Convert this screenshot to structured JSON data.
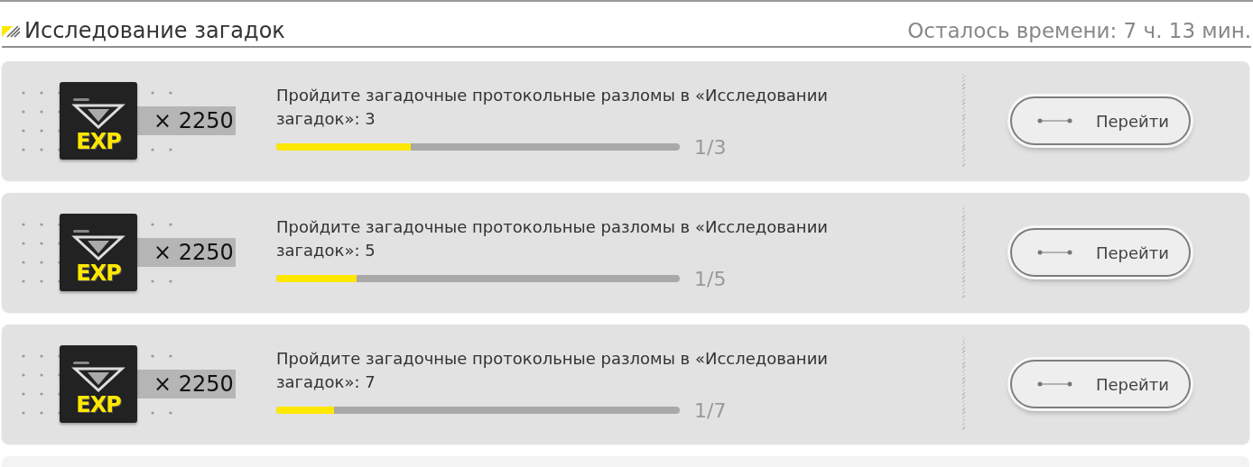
{
  "section": {
    "title": "Исследование загадок",
    "time_left": "Осталось времени: 7 ч. 13 мин."
  },
  "tasks": [
    {
      "reward_badge": "EXP",
      "reward_amount": "× 2250",
      "description": "Пройдите загадочные протокольные разломы в «Исследовании загадок»: 3",
      "level": 0.333,
      "reading": "1/3",
      "button": "Перейти"
    },
    {
      "reward_badge": "EXP",
      "reward_amount": "× 2250",
      "description": "Пройдите загадочные протокольные разломы в «Исследовании загадок»: 5",
      "level": 0.2,
      "reading": "1/5",
      "button": "Перейти"
    },
    {
      "reward_badge": "EXP",
      "reward_amount": "× 2250",
      "description": "Пройдите загадочные протокольные разломы в «Исследовании загадок»: 7",
      "level": 0.143,
      "reading": "1/7",
      "button": "Перейти"
    }
  ]
}
